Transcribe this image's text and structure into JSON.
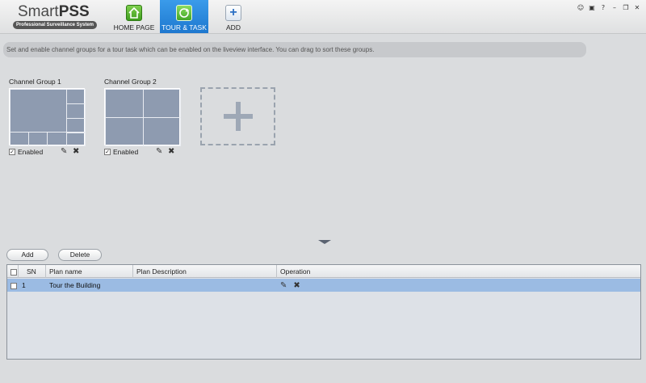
{
  "app": {
    "logo_title_a": "Smart",
    "logo_title_b": "PSS",
    "logo_subtitle": "Professional Surveillance System"
  },
  "nav": {
    "home": "HOME PAGE",
    "tour": "TOUR & TASK",
    "add": "ADD"
  },
  "window_controls": {
    "user": "☺",
    "lock": "▣",
    "help": "?",
    "minimize": "–",
    "restore": "❐",
    "close": "✕"
  },
  "info_text": "Set and enable channel groups for a tour task which can be enabled on the liveview interface. You can drag to sort these groups.",
  "groups": [
    {
      "title": "Channel Group 1",
      "enabled_label": "Enabled",
      "checked": "✓"
    },
    {
      "title": "Channel Group 2",
      "enabled_label": "Enabled",
      "checked": "✓"
    }
  ],
  "icons": {
    "edit": "✎",
    "delete": "✖"
  },
  "buttons": {
    "add": "Add",
    "delete": "Delete"
  },
  "table": {
    "headers": {
      "sn": "SN",
      "name": "Plan name",
      "desc": "Plan Description",
      "op": "Operation"
    },
    "rows": [
      {
        "sn": "1",
        "name": "Tour the Building",
        "desc": ""
      }
    ]
  },
  "colors": {
    "accent": "#1e78cf",
    "selected_row": "#9bbbe3",
    "thumb": "#8e9bb0"
  }
}
